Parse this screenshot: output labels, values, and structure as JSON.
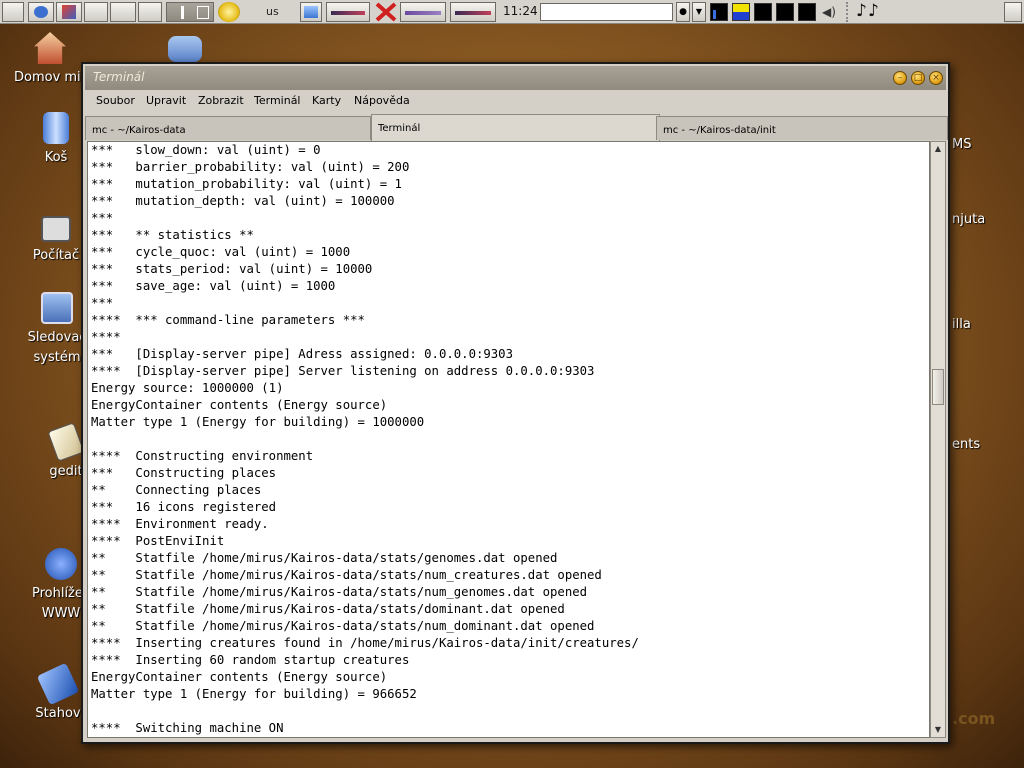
{
  "panel": {
    "keyboard_layout": "us",
    "clock": "11:24",
    "command_value": "",
    "icons": [
      "show-desktop-icon",
      "browser-icon",
      "editor-icon",
      "window-icon",
      "window-icon",
      "window-icon",
      "pager-icon",
      "gimp-icon",
      "network-icon",
      "cpu-monitor-icon",
      "close-x-icon",
      "mem-monitor-icon",
      "load-monitor-icon",
      "volume-icon",
      "note-icon"
    ]
  },
  "desktop": {
    "icons": [
      {
        "label": "Domov mir"
      },
      {
        "label": "Koš"
      },
      {
        "label": "Počítač"
      },
      {
        "label": "Sledovač systém"
      },
      {
        "label": "gedit"
      },
      {
        "label": "Prohlížeč WWW"
      },
      {
        "label": "Stahov"
      }
    ],
    "right_labels": [
      "MS",
      "njuta",
      "illa",
      "ents",
      ".com"
    ]
  },
  "window": {
    "title": "Terminál",
    "menu": [
      "Soubor",
      "Upravit",
      "Zobrazit",
      "Terminál",
      "Karty",
      "Nápověda"
    ],
    "tabs": [
      {
        "label": "mc - ~/Kairos-data",
        "active": false
      },
      {
        "label": "Terminál",
        "active": true
      },
      {
        "label": "mc - ~/Kairos-data/init",
        "active": false
      }
    ],
    "terminal_lines": [
      "***   slow_down: val (uint) = 0",
      "***   barrier_probability: val (uint) = 200",
      "***   mutation_probability: val (uint) = 1",
      "***   mutation_depth: val (uint) = 100000",
      "***",
      "***   ** statistics **",
      "***   cycle_quoc: val (uint) = 1000",
      "***   stats_period: val (uint) = 10000",
      "***   save_age: val (uint) = 1000",
      "***",
      "****  *** command-line parameters ***",
      "****",
      "***   [Display-server pipe] Adress assigned: 0.0.0.0:9303",
      "****  [Display-server pipe] Server listening on address 0.0.0.0:9303",
      "Energy source: 1000000 (1)",
      "EnergyContainer contents (Energy source)",
      "Matter type 1 (Energy for building) = 1000000",
      "",
      "****  Constructing environment",
      "***   Constructing places",
      "**    Connecting places",
      "***   16 icons registered",
      "****  Environment ready.",
      "****  PostEnviInit",
      "**    Statfile /home/mirus/Kairos-data/stats/genomes.dat opened",
      "**    Statfile /home/mirus/Kairos-data/stats/num_creatures.dat opened",
      "**    Statfile /home/mirus/Kairos-data/stats/num_genomes.dat opened",
      "**    Statfile /home/mirus/Kairos-data/stats/dominant.dat opened",
      "**    Statfile /home/mirus/Kairos-data/stats/num_dominant.dat opened",
      "****  Inserting creatures found in /home/mirus/Kairos-data/init/creatures/",
      "****  Inserting 60 random startup creatures",
      "EnergyContainer contents (Energy source)",
      "Matter type 1 (Energy for building) = 966652",
      "",
      "****  Switching machine ON"
    ]
  },
  "colors": {
    "desktop": "#8a5a22",
    "panel": "#d6d3cc",
    "titlebar": "#9c978a",
    "terminal_bg": "#ffffff"
  }
}
